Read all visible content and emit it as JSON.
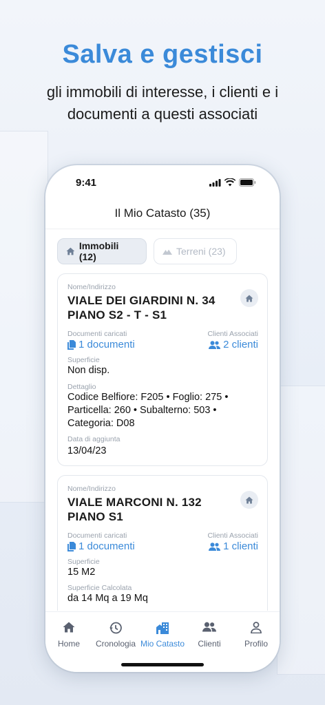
{
  "headline": "Salva e gestisci",
  "subline": "gli immobili di interesse, i clienti e i documenti a questi associati",
  "status": {
    "time": "9:41"
  },
  "screen_title": "Il Mio Catasto (35)",
  "segments": [
    {
      "label": "Immobili (12)",
      "icon": "house-icon",
      "active": true
    },
    {
      "label": "Terreni (23)",
      "icon": "mountain-icon",
      "active": false
    }
  ],
  "cards": [
    {
      "name_label": "Nome/Indirizzo",
      "name": "VIALE DEI GIARDINI N. 34 PIANO S2 - T - S1",
      "docs_label": "Documenti caricati",
      "docs": "1 documenti",
      "clients_label": "Clienti Associati",
      "clients": "2 clienti",
      "surface_label": "Superficie",
      "surface": "Non disp.",
      "detail_label": "Dettaglio",
      "detail": "Codice Belfiore: F205 • Foglio: 275 • Particella: 260 • Subalterno: 503 • Categoria: D08",
      "date_label": "Data di aggiunta",
      "date": "13/04/23"
    },
    {
      "name_label": "Nome/Indirizzo",
      "name": "VIALE MARCONI N. 132 PIANO S1",
      "docs_label": "Documenti caricati",
      "docs": "1 documenti",
      "clients_label": "Clienti Associati",
      "clients": "1 clienti",
      "surface_label": "Superficie",
      "surface": "15 M2",
      "calc_label": "Superficie Calcolata",
      "calc": "da 14 Mq a 19 Mq"
    }
  ],
  "tabs": [
    {
      "label": "Home",
      "icon": "home-icon"
    },
    {
      "label": "Cronologia",
      "icon": "history-icon"
    },
    {
      "label": "Mio Catasto",
      "icon": "buildings-icon",
      "active": true
    },
    {
      "label": "Clienti",
      "icon": "people-icon"
    },
    {
      "label": "Profilo",
      "icon": "person-icon"
    }
  ],
  "colors": {
    "accent": "#3b8ad9",
    "text": "#1a1a1a",
    "muted": "#9aa2ad"
  }
}
